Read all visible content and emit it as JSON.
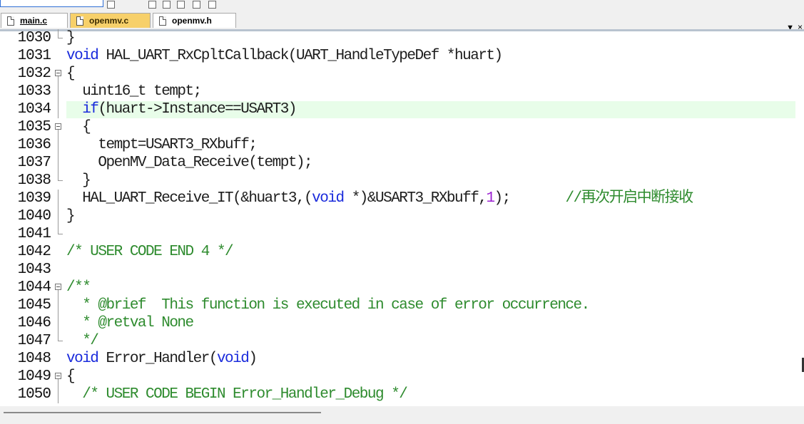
{
  "tabs": [
    {
      "label": "main.c",
      "active": true
    },
    {
      "label": "openmv.c",
      "active": false
    },
    {
      "label": "openmv.h",
      "active": false
    }
  ],
  "tab_controls": {
    "menu_icon": "▼",
    "close_icon": "×"
  },
  "lines": [
    {
      "num": "1030",
      "html": "}"
    },
    {
      "num": "1031",
      "html": "<span class=\"k\">void</span> HAL_UART_RxCpltCallback(UART_HandleTypeDef *huart)"
    },
    {
      "num": "1032",
      "html": "{"
    },
    {
      "num": "1033",
      "html": "  uint16_t tempt;"
    },
    {
      "num": "1034",
      "html": "  <span class=\"k\">if</span>(huart-&gt;Instance==USART3)"
    },
    {
      "num": "1035",
      "html": "  {"
    },
    {
      "num": "1036",
      "html": "    tempt=USART3_RXbuff;"
    },
    {
      "num": "1037",
      "html": "    OpenMV_Data_Receive(tempt);"
    },
    {
      "num": "1038",
      "html": "  }"
    },
    {
      "num": "1039",
      "html": "  HAL_UART_Receive_IT(&amp;huart3,(<span class=\"k\">void</span> *)&amp;USART3_RXbuff,<span class=\"n\">1</span>);       <span class=\"c\">//再次开启中断接收</span>"
    },
    {
      "num": "1040",
      "html": "}"
    },
    {
      "num": "1041",
      "html": ""
    },
    {
      "num": "1042",
      "html": "<span class=\"c\">/* USER CODE END 4 */</span>"
    },
    {
      "num": "1043",
      "html": ""
    },
    {
      "num": "1044",
      "html": "<span class=\"c\">/**</span>"
    },
    {
      "num": "1045",
      "html": "<span class=\"c\">  * @brief  This function is executed in case of error occurrence.</span>"
    },
    {
      "num": "1046",
      "html": "<span class=\"c\">  * @retval None</span>"
    },
    {
      "num": "1047",
      "html": "<span class=\"c\">  */</span>"
    },
    {
      "num": "1048",
      "html": "<span class=\"k\">void</span> Error_Handler(<span class=\"k\">void</span>)"
    },
    {
      "num": "1049",
      "html": "{"
    },
    {
      "num": "1050",
      "html": "  <span class=\"c\">/* USER CODE BEGIN Error_Handler_Debug */</span>"
    }
  ],
  "highlighted_line": "1034",
  "colors": {
    "keyword": "#1a2bdc",
    "comment": "#2e8b2e",
    "number": "#9b1fd1",
    "highlight": "#e8fde9",
    "active_tab_bg": "#ffffff",
    "inactive_tab_bg": "#f7d06a"
  }
}
